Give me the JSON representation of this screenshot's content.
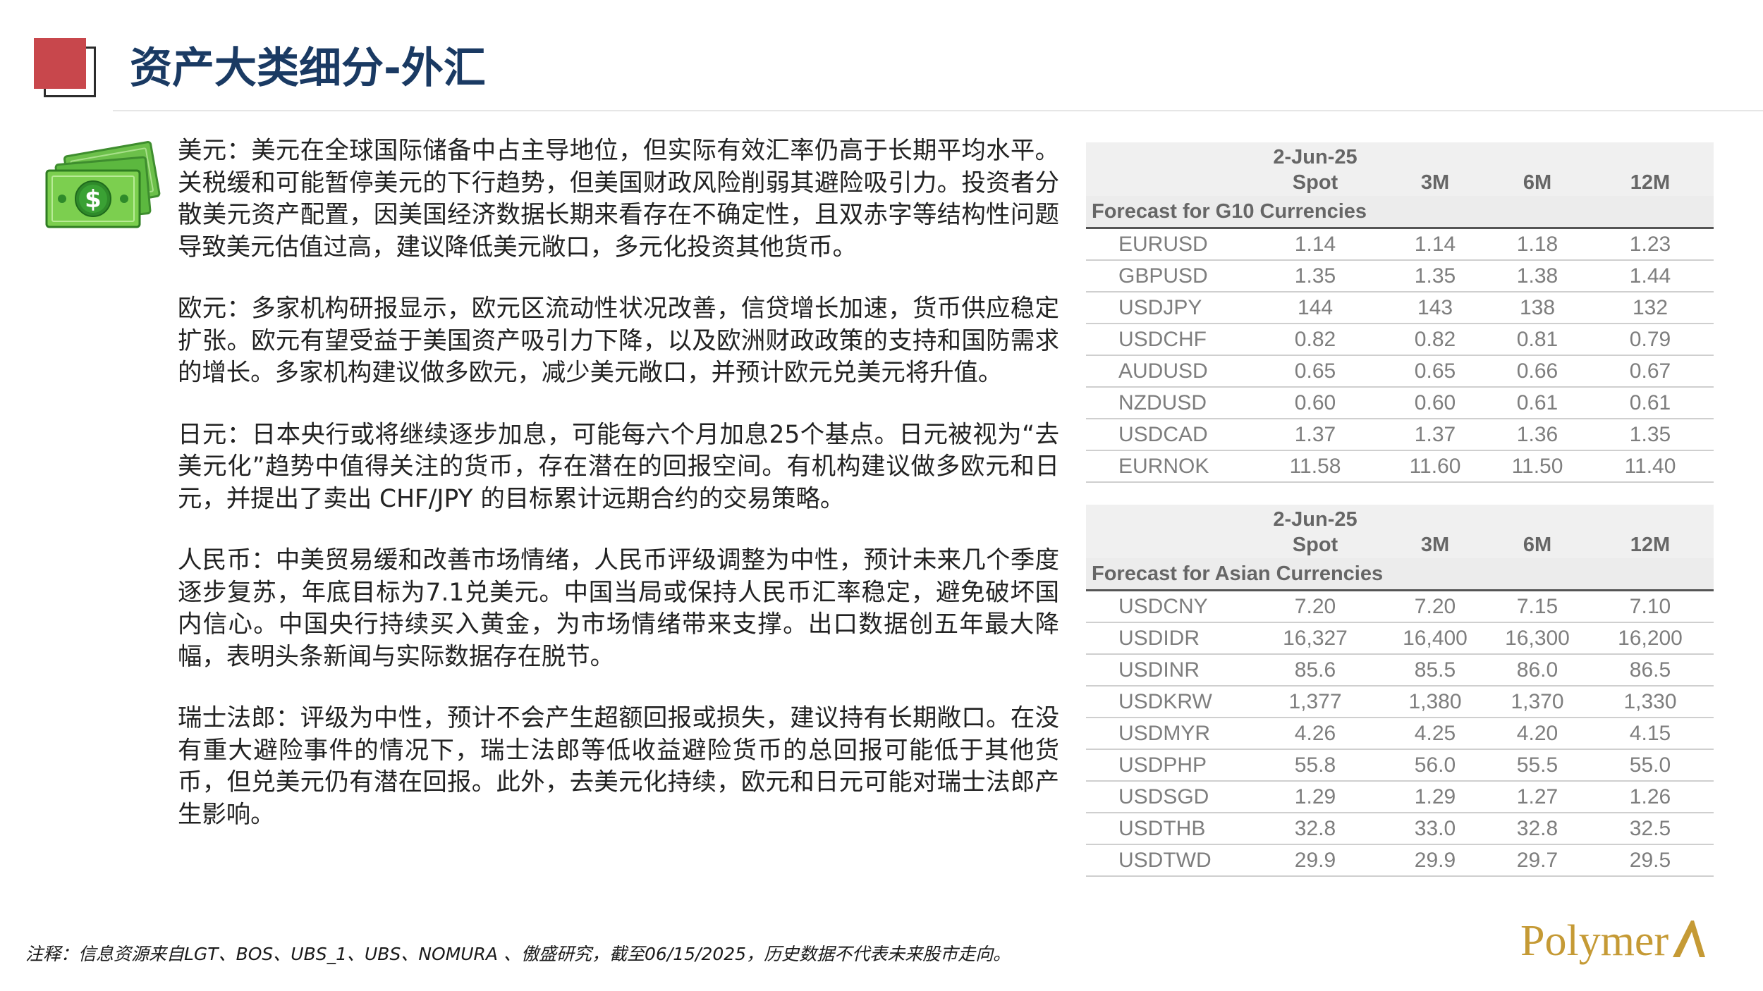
{
  "header": {
    "title": "资产大类细分-外汇"
  },
  "paragraphs": [
    "美元：美元在全球国际储备中占主导地位，但实际有效汇率仍高于长期平均水平。关税缓和可能暂停美元的下行趋势，但美国财政风险削弱其避险吸引力。投资者分散美元资产配置，因美国经济数据长期来看存在不确定性，且双赤字等结构性问题导致美元估值过高，建议降低美元敞口，多元化投资其他货币。",
    "欧元：多家机构研报显示，欧元区流动性状况改善，信贷增长加速，货币供应稳定扩张。欧元有望受益于美国资产吸引力下降，以及欧洲财政政策的支持和国防需求的增长。多家机构建议做多欧元，减少美元敞口，并预计欧元兑美元将升值。",
    "日元：日本央行或将继续逐步加息，可能每六个月加息25个基点。日元被视为“去美元化”趋势中值得关注的货币，存在潜在的回报空间。有机构建议做多欧元和日元，并提出了卖出 CHF/JPY 的目标累计远期合约的交易策略。",
    "人民币：中美贸易缓和改善市场情绪，人民币评级调整为中性，预计未来几个季度逐步复苏，年底目标为7.1兑美元。中国当局或保持人民币汇率稳定，避免破坏国内信心。中国央行持续买入黄金，为市场情绪带来支撑。出口数据创五年最大降幅，表明头条新闻与实际数据存在脱节。",
    "瑞士法郎：评级为中性，预计不会产生超额回报或损失，建议持有长期敞口。在没有重大避险事件的情况下，瑞士法郎等低收益避险货币的总回报可能低于其他货币，但兑美元仍有潜在回报。此外，去美元化持续，欧元和日元可能对瑞士法郎产生影响。"
  ],
  "tables": [
    {
      "date_label": "2-Jun-25",
      "columns": [
        "Spot",
        "3M",
        "6M",
        "12M"
      ],
      "section": "Forecast for G10 Currencies",
      "rows": [
        [
          "EURUSD",
          "1.14",
          "1.14",
          "1.18",
          "1.23"
        ],
        [
          "GBPUSD",
          "1.35",
          "1.35",
          "1.38",
          "1.44"
        ],
        [
          "USDJPY",
          "144",
          "143",
          "138",
          "132"
        ],
        [
          "USDCHF",
          "0.82",
          "0.82",
          "0.81",
          "0.79"
        ],
        [
          "AUDUSD",
          "0.65",
          "0.65",
          "0.66",
          "0.67"
        ],
        [
          "NZDUSD",
          "0.60",
          "0.60",
          "0.61",
          "0.61"
        ],
        [
          "USDCAD",
          "1.37",
          "1.37",
          "1.36",
          "1.35"
        ],
        [
          "EURNOK",
          "11.58",
          "11.60",
          "11.50",
          "11.40"
        ]
      ]
    },
    {
      "date_label": "2-Jun-25",
      "columns": [
        "Spot",
        "3M",
        "6M",
        "12M"
      ],
      "section": "Forecast for Asian Currencies",
      "rows": [
        [
          "USDCNY",
          "7.20",
          "7.20",
          "7.15",
          "7.10"
        ],
        [
          "USDIDR",
          "16,327",
          "16,400",
          "16,300",
          "16,200"
        ],
        [
          "USDINR",
          "85.6",
          "85.5",
          "86.0",
          "86.5"
        ],
        [
          "USDKRW",
          "1,377",
          "1,380",
          "1,370",
          "1,330"
        ],
        [
          "USDMYR",
          "4.26",
          "4.25",
          "4.20",
          "4.15"
        ],
        [
          "USDPHP",
          "55.8",
          "56.0",
          "55.5",
          "55.0"
        ],
        [
          "USDSGD",
          "1.29",
          "1.29",
          "1.27",
          "1.26"
        ],
        [
          "USDTHB",
          "32.8",
          "33.0",
          "32.8",
          "32.5"
        ],
        [
          "USDTWD",
          "29.9",
          "29.9",
          "29.7",
          "29.5"
        ]
      ]
    }
  ],
  "footer": {
    "note": "注释：信息资源来自LGT、BOS、UBS_1、UBS、NOMURA 、傲盛研究，截至06/15/2025，历史数据不代表未来股市走向。",
    "logo_text": "Polymer"
  },
  "colors": {
    "title": "#1a3a63",
    "accent_red": "#c8474c",
    "logo_gold": "#c59a35",
    "money_green": "#4caf50"
  },
  "icons": [
    "money-icon",
    "logo-a-mark"
  ]
}
